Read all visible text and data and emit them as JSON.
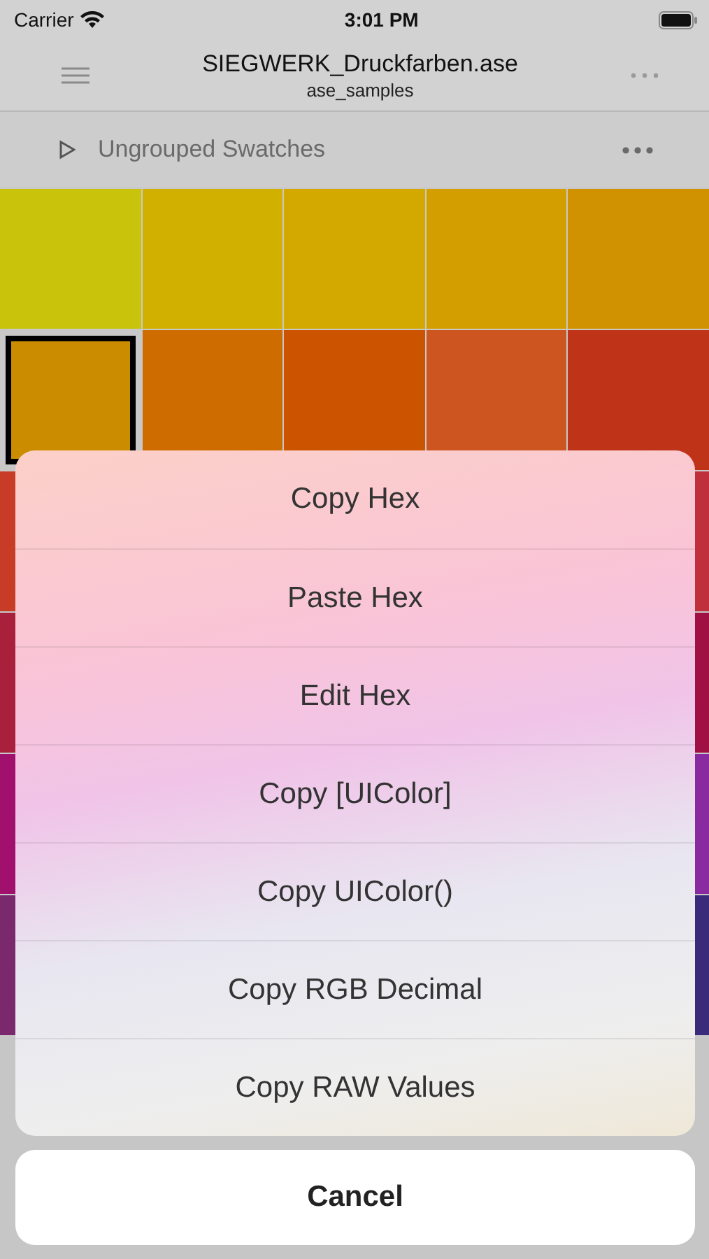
{
  "status_bar": {
    "carrier": "Carrier",
    "time": "3:01 PM"
  },
  "nav_bar": {
    "title": "SIEGWERK_Druckfarben.ase",
    "subtitle": "ase_samples"
  },
  "group": {
    "title": "Ungrouped Swatches",
    "expanded": false
  },
  "swatch_rows": [
    [
      {
        "color": "#c9c30c",
        "selected": false
      },
      {
        "color": "#d2b000",
        "selected": false
      },
      {
        "color": "#d3a900",
        "selected": false
      },
      {
        "color": "#d39f00",
        "selected": false
      },
      {
        "color": "#d09200",
        "selected": false
      }
    ],
    [
      {
        "color": "#cc8c00",
        "selected": true
      },
      {
        "color": "#cf6c00",
        "selected": false
      },
      {
        "color": "#cc5300",
        "selected": false
      },
      {
        "color": "#cc5520",
        "selected": false
      },
      {
        "color": "#bf3418",
        "selected": false
      }
    ],
    [
      {
        "color": "#c83b26",
        "selected": false
      },
      {
        "color": "#c0303c",
        "selected": false
      }
    ],
    [
      {
        "color": "#a8203c",
        "selected": false
      },
      {
        "color": "#a01042",
        "selected": false
      }
    ],
    [
      {
        "color": "#a0106c",
        "selected": false
      },
      {
        "color": "#8a2aa0",
        "selected": false
      }
    ],
    [
      {
        "color": "#7a2a6c",
        "selected": false
      },
      {
        "color": "#3a2a7a",
        "selected": false
      }
    ]
  ],
  "action_sheet": {
    "actions": [
      "Copy Hex",
      "Paste Hex",
      "Edit Hex",
      "Copy [UIColor]",
      "Copy UIColor()",
      "Copy RGB Decimal",
      "Copy RAW Values"
    ],
    "cancel": "Cancel"
  }
}
